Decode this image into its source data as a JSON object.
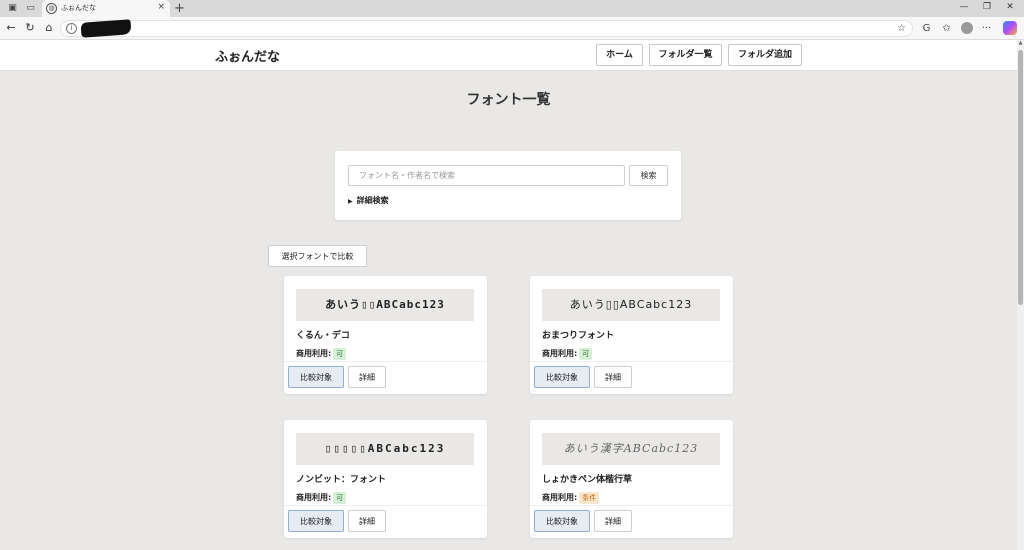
{
  "browser": {
    "tab_title": "ふぉんだな",
    "tab_close": "×",
    "new_tab": "+",
    "url_redacted": true,
    "icons": {
      "workspaces": "▣",
      "tab_actions": "▭",
      "back": "←",
      "reload": "↻",
      "home": "⌂",
      "favorite": "☆",
      "refresh_ext": "G",
      "collections": "✩",
      "more": "···",
      "minimize": "—",
      "restore": "❐",
      "close": "✕"
    }
  },
  "site": {
    "brand": "ふぉんだな",
    "nav": [
      {
        "label": "ホーム"
      },
      {
        "label": "フォルダ一覧"
      },
      {
        "label": "フォルダ追加"
      }
    ]
  },
  "page": {
    "title": "フォント一覧"
  },
  "search": {
    "placeholder": "フォント名・作者名で検索",
    "button_label": "検索",
    "advanced_label": "詳細検索",
    "advanced_marker": "▶"
  },
  "compare_selected_label": "選択フォントで比較",
  "fonts": [
    {
      "preview": "あいう▯▯ABCabc123",
      "name": "くるん・デコ",
      "commercial_label": "商用利用:",
      "commercial_value": "可",
      "status": "ok",
      "compare_label": "比較対象",
      "detail_label": "詳細"
    },
    {
      "preview": "あいう▯▯ABCabc123",
      "name": "おまつりフォント",
      "commercial_label": "商用利用:",
      "commercial_value": "可",
      "status": "ok",
      "compare_label": "比較対象",
      "detail_label": "詳細"
    },
    {
      "preview": "▯▯▯▯▯ABCabc123",
      "name": "ノンビット：フォント",
      "commercial_label": "商用利用:",
      "commercial_value": "可",
      "status": "ok",
      "compare_label": "比較対象",
      "detail_label": "詳細"
    },
    {
      "preview": "あいう漢字ABCabc123",
      "name": "しょかきペン体楷行草",
      "commercial_label": "商用利用:",
      "commercial_value": "条件",
      "status": "conditional",
      "compare_label": "比較対象",
      "detail_label": "詳細"
    }
  ]
}
